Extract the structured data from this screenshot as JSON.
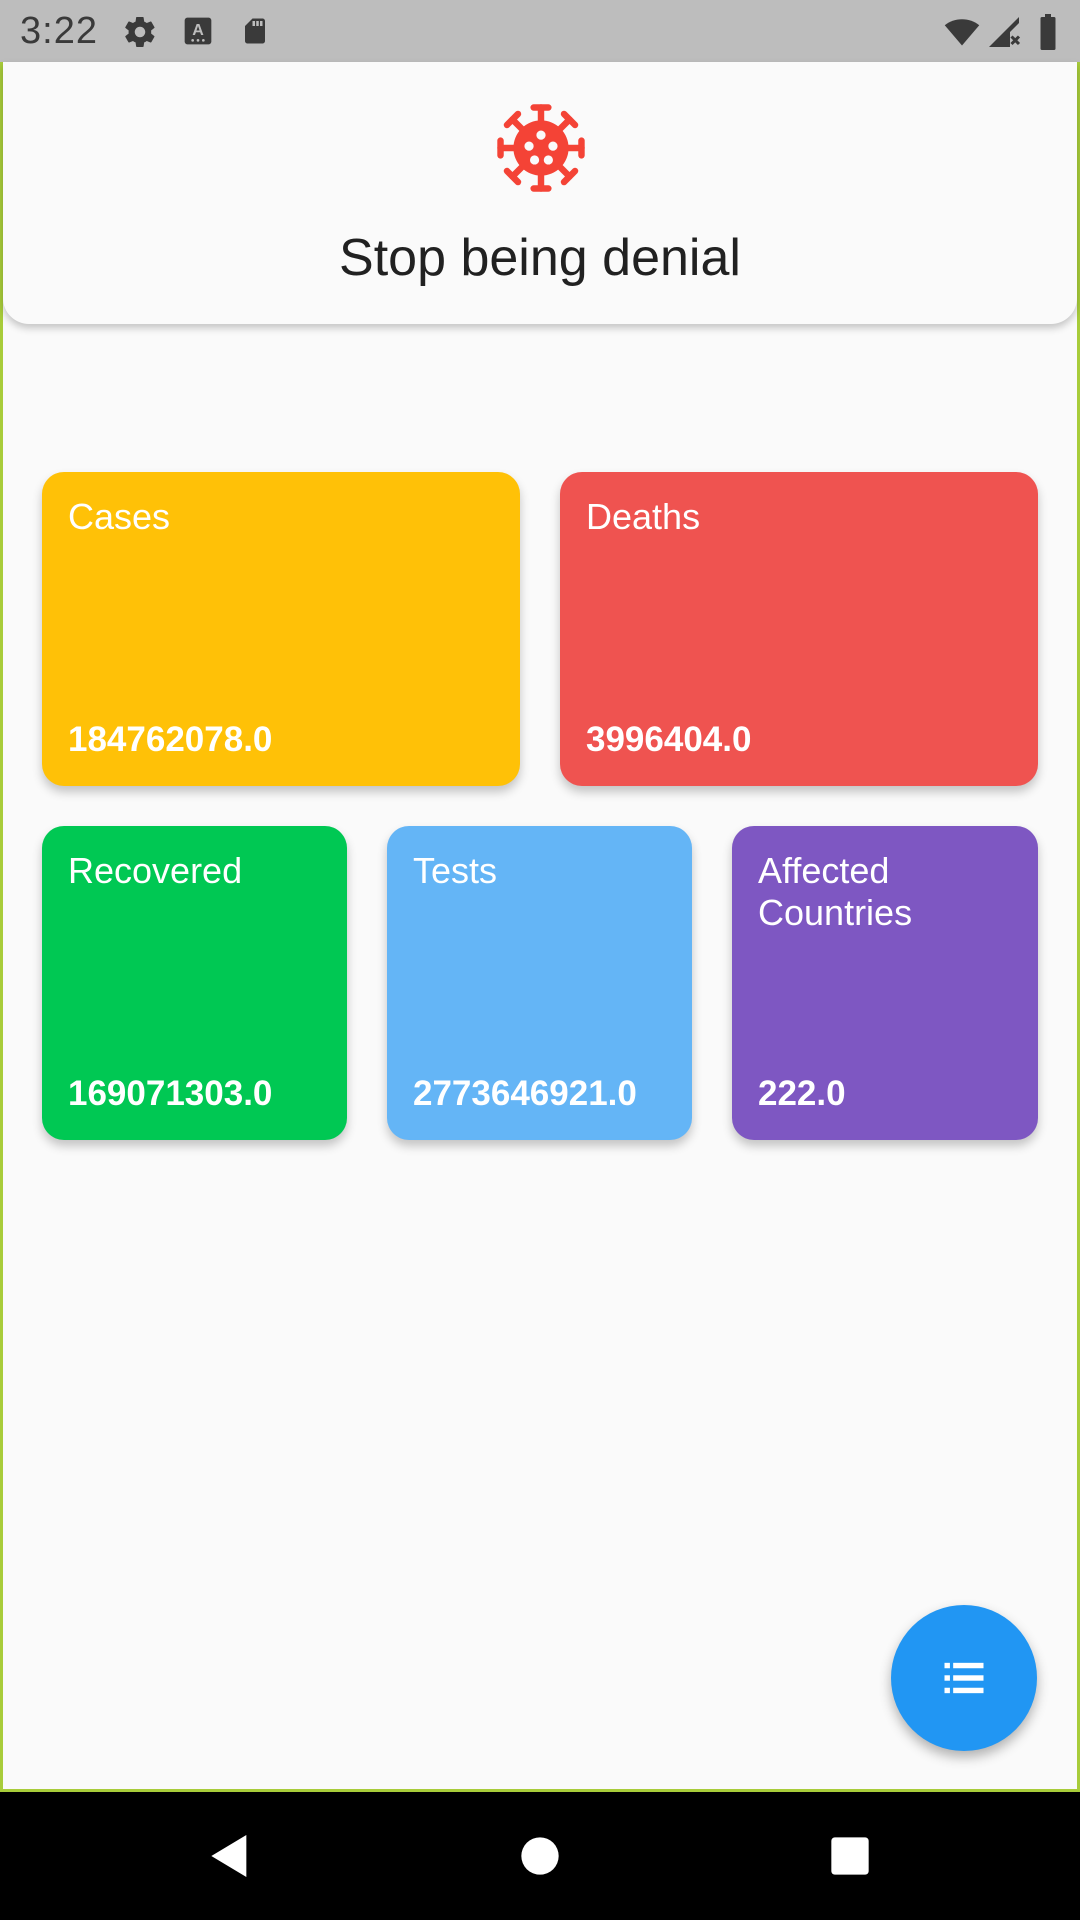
{
  "status_bar": {
    "time": "3:22",
    "icons": [
      "settings-icon",
      "keyboard-a-icon",
      "sd-card-icon",
      "wifi-icon",
      "cellular-no-signal-icon",
      "battery-icon"
    ]
  },
  "header": {
    "icon": "virus-icon",
    "title": "Stop being denial",
    "accent": "#f44336"
  },
  "stats": [
    {
      "label": "Cases",
      "value": "184762078.0",
      "color": "#ffc107"
    },
    {
      "label": "Deaths",
      "value": "3996404.0",
      "color": "#ef5350"
    },
    {
      "label": "Recovered",
      "value": "169071303.0",
      "color": "#00c853"
    },
    {
      "label": "Tests",
      "value": "2773646921.0",
      "color": "#64b5f6"
    },
    {
      "label": "Affected Countries",
      "value": "222.0",
      "color": "#7e57c2"
    }
  ],
  "fab": {
    "icon": "list-icon",
    "color": "#2196f3"
  },
  "nav_bar": {
    "buttons": [
      "back-icon",
      "home-icon",
      "recents-icon"
    ]
  }
}
